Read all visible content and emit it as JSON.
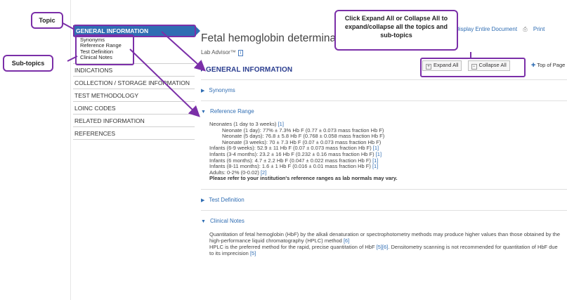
{
  "callouts": {
    "topic": "Topic",
    "subtopics": "Sub-topics",
    "expand_note": "Click Expand All or Collapse All to expand/collapse all the topics and sub-topics"
  },
  "top_links": {
    "display_entire": "Display Entire Document",
    "print": "Print"
  },
  "sidebar": {
    "active_topic": "GENERAL INFORMATION",
    "subtopics": [
      "Synonyms",
      "Reference Range",
      "Test Definition",
      "Clinical Notes"
    ],
    "items": [
      "INDICATIONS",
      "COLLECTION / STORAGE INFORMATION",
      "TEST METHODOLOGY",
      "LOINC CODES",
      "RELATED INFORMATION",
      "REFERENCES"
    ]
  },
  "main": {
    "title": "Fetal hemoglobin determinat",
    "lab_advisor": "Lab Advisor™",
    "tm_icon_label": "i",
    "section_heading": "GENERAL INFORMATION",
    "expand_all": "Expand All",
    "collapse_all": "Collapse All",
    "top_of_page": "Top of Page",
    "sections": {
      "synonyms": "Synonyms",
      "reference_range": "Reference Range",
      "test_definition": "Test Definition",
      "clinical_notes": "Clinical Notes"
    },
    "reference_range": {
      "neonates": "Neonates (1 day to 3 weeks)",
      "neonates_ref": "[1]",
      "neo_lines": [
        "Neonate (1 day): 77% ± 7.3% Hb F (0.77 ± 0.073 mass fraction Hb F)",
        "Neonate (5 days): 76.8 ± 5.8 Hb F (0.768 ± 0.058 mass fraction Hb F)",
        "Neonate (3 weeks): 70 ± 7.3 Hb F (0.07 ± 0.073 mass fraction Hb F)"
      ],
      "infant_lines": [
        {
          "text": "Infants (6-9 weeks): 52.9 ± 11 Hb F (0.07 ± 0.073 mass fraction Hb F)",
          "ref": "[1]"
        },
        {
          "text": "Infants (3-4 months): 23.2 ± 16 Hb F (0.232 ± 0.16 mass fraction Hb F)",
          "ref": "[1]"
        },
        {
          "text": "Infants (6 months): 4.7 ± 2.2 Hb F (0.047 ± 0.022 mass fraction Hb F)",
          "ref": "[1]"
        },
        {
          "text": "Infants (8-11 months): 1.6 ± 1 Hb F (0.016 ± 0.01 mass fraction Hb F)",
          "ref": "[1]"
        }
      ],
      "adults": "Adults: 0-2% (0-0.02)",
      "adults_ref": "[2]",
      "note": "Please refer to your institution's reference ranges as lab normals may vary."
    },
    "clinical_notes": {
      "p1": "Quantitation of fetal hemoglobin (HbF) by the alkali denaturation or spectrophotometry methods may produce higher values than those obtained by the high-performance liquid chromatography (HPLC) method",
      "p1_ref": "[6]",
      "p2": "HPLC is the preferred method for the rapid, precise quantitation of HbF",
      "p2_ref": "[5][6]",
      "p2b": ". Densitometry scanning is not recommended for quantitation of HbF due to its imprecision",
      "p2b_ref": "[5]"
    }
  },
  "colors": {
    "accent": "#2f6db3",
    "callout_border": "#7b2fa8",
    "heading": "#2a3d8f"
  },
  "icons": [
    "print-icon",
    "tm-info-icon",
    "expand-icon",
    "collapse-icon",
    "top-of-page-icon",
    "expand-arrow-icon"
  ]
}
